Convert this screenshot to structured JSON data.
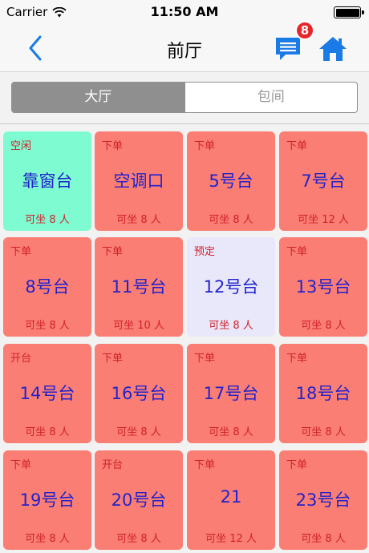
{
  "status_bar": {
    "carrier": "Carrier",
    "time": "11:50 AM",
    "wifi_icon": "wifi-icon",
    "battery_icon": "battery-icon"
  },
  "nav": {
    "title": "前厅",
    "back_icon": "chevron-left-icon",
    "message_icon": "message-icon",
    "message_badge": "8",
    "home_icon": "home-icon",
    "accent_color": "#1a7ae6"
  },
  "segments": [
    {
      "label": "大厅",
      "active": true
    },
    {
      "label": "包间",
      "active": false
    }
  ],
  "colors": {
    "free": "#7ffbd1",
    "busy": "#fa7e73",
    "reserved": "#e8e8fa",
    "name_text": "#2222cc",
    "status_text": "#d0202a"
  },
  "tables": [
    {
      "status": "空闲",
      "name": "靠窗台",
      "seats": "可坐 8 人",
      "state": "free"
    },
    {
      "status": "下单",
      "name": "空调口",
      "seats": "可坐 8 人",
      "state": "busy"
    },
    {
      "status": "下单",
      "name": "5号台",
      "seats": "可坐 8 人",
      "state": "busy"
    },
    {
      "status": "下单",
      "name": "7号台",
      "seats": "可坐 12 人",
      "state": "busy"
    },
    {
      "status": "下单",
      "name": "8号台",
      "seats": "可坐 8 人",
      "state": "busy"
    },
    {
      "status": "下单",
      "name": "11号台",
      "seats": "可坐 10 人",
      "state": "busy"
    },
    {
      "status": "预定",
      "name": "12号台",
      "seats": "可坐 8 人",
      "state": "reserved"
    },
    {
      "status": "下单",
      "name": "13号台",
      "seats": "可坐 8 人",
      "state": "busy"
    },
    {
      "status": "开台",
      "name": "14号台",
      "seats": "可坐 8 人",
      "state": "busy"
    },
    {
      "status": "下单",
      "name": "16号台",
      "seats": "可坐 8 人",
      "state": "busy"
    },
    {
      "status": "下单",
      "name": "17号台",
      "seats": "可坐 8 人",
      "state": "busy"
    },
    {
      "status": "下单",
      "name": "18号台",
      "seats": "可坐 8 人",
      "state": "busy"
    },
    {
      "status": "下单",
      "name": "19号台",
      "seats": "可坐 8 人",
      "state": "busy"
    },
    {
      "status": "开台",
      "name": "20号台",
      "seats": "可坐 8 人",
      "state": "busy"
    },
    {
      "status": "下单",
      "name": "21",
      "seats": "可坐 12 人",
      "state": "busy"
    },
    {
      "status": "下单",
      "name": "23号台",
      "seats": "可坐 8 人",
      "state": "busy"
    }
  ]
}
